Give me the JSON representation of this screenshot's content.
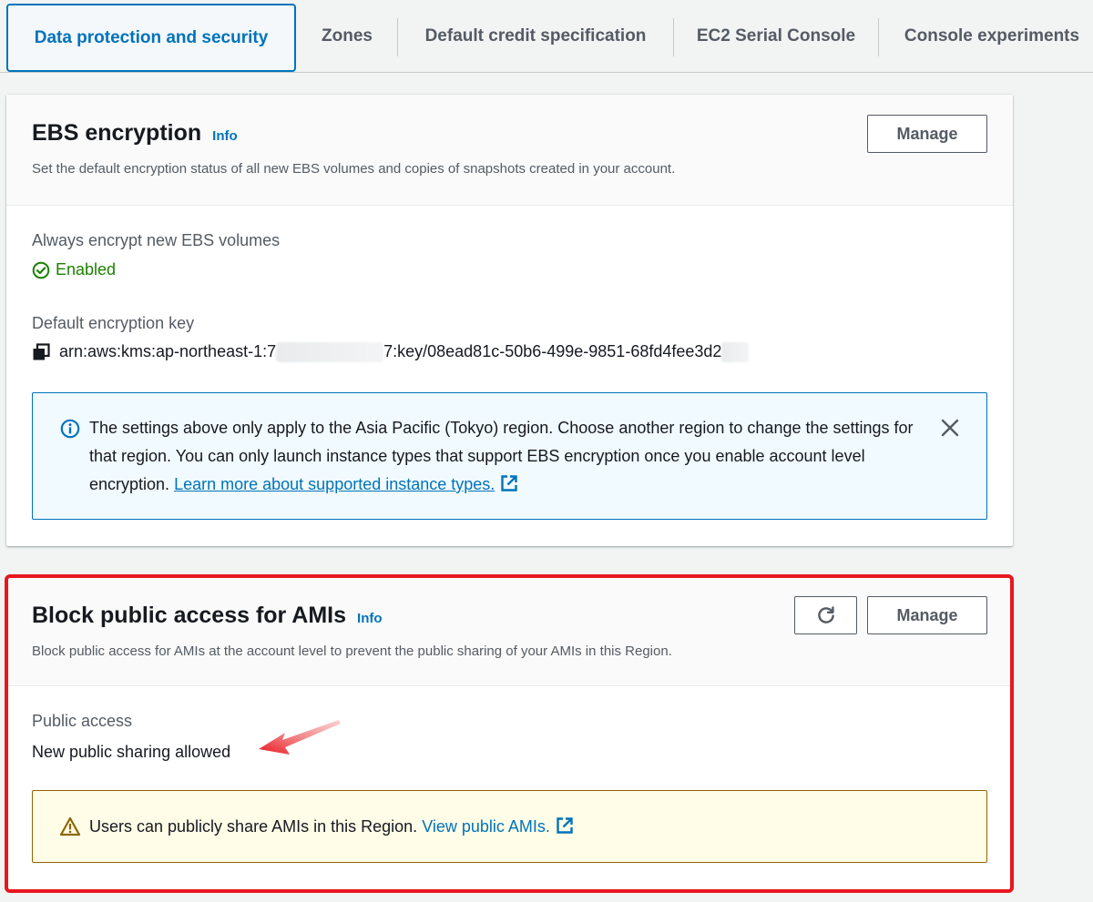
{
  "tabs": [
    {
      "label": "Data protection and security",
      "active": true
    },
    {
      "label": "Zones"
    },
    {
      "label": "Default credit specification"
    },
    {
      "label": "EC2 Serial Console"
    },
    {
      "label": "Console experiments"
    }
  ],
  "ebs": {
    "title": "EBS encryption",
    "info": "Info",
    "description": "Set the default encryption status of all new EBS volumes and copies of snapshots created in your account.",
    "manage_label": "Manage",
    "always_encrypt_label": "Always encrypt new EBS volumes",
    "status": "Enabled",
    "key_label": "Default encryption key",
    "key_prefix": "arn:aws:kms:ap-northeast-1:7",
    "key_middle": "7:key/08ead81c-50b6-499e-9851-68fd4fee3d2",
    "alert_text": "The settings above only apply to the Asia Pacific (Tokyo) region. Choose another region to change the settings for that region. You can only launch instance types that support EBS encryption once you enable account level encryption.",
    "alert_link": "Learn more about supported instance types."
  },
  "ami": {
    "title": "Block public access for AMIs",
    "info": "Info",
    "description": "Block public access for AMIs at the account level to prevent the public sharing of your AMIs in this Region.",
    "manage_label": "Manage",
    "public_access_label": "Public access",
    "public_access_value": "New public sharing allowed",
    "warning_text": "Users can publicly share AMIs in this Region.",
    "warning_link": "View public AMIs."
  },
  "colors": {
    "accent": "#0073bb",
    "success": "#1d8102",
    "warning": "#8d6605",
    "annotation": "#e8171f"
  },
  "icons": {
    "status": "check-circle-icon",
    "copy": "copy-icon",
    "info": "info-circle-icon",
    "close": "close-icon",
    "external": "external-link-icon",
    "warning": "warning-triangle-icon",
    "refresh": "refresh-icon"
  }
}
